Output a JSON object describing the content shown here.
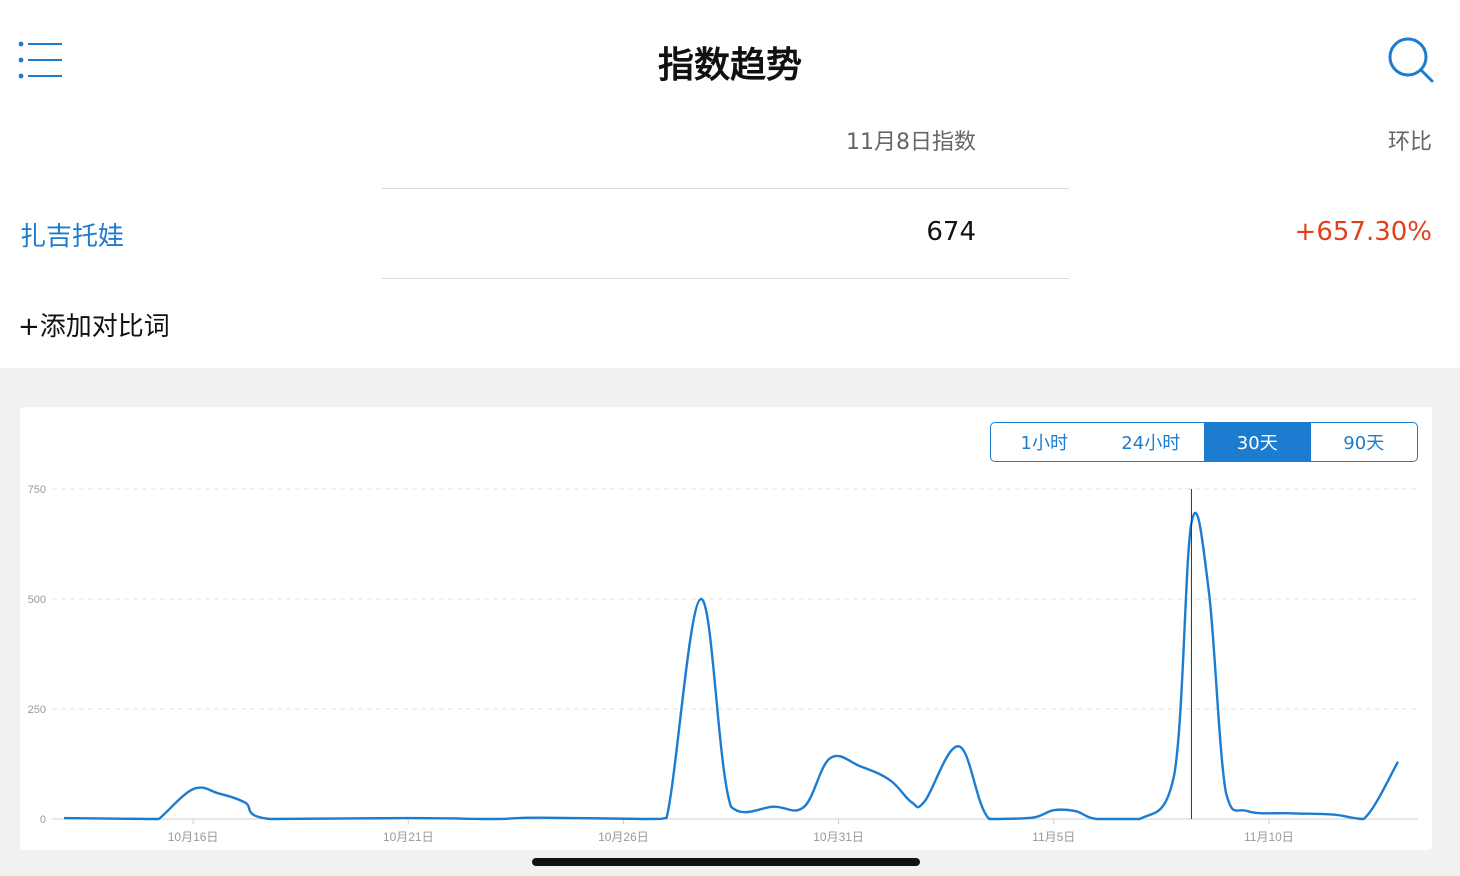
{
  "header": {
    "title": "指数趋势",
    "menu_icon": "menu-list-icon",
    "search_icon": "search-icon"
  },
  "summary": {
    "col_value_label": "11月8日指数",
    "col_ratio_label": "环比",
    "keyword": "扎吉托娃",
    "index_value": "674",
    "ratio_value": "+657.30%",
    "add_compare_label": "+添加对比词"
  },
  "range_tabs": [
    {
      "label": "1小时",
      "active": false
    },
    {
      "label": "24小时",
      "active": false
    },
    {
      "label": "30天",
      "active": true
    },
    {
      "label": "90天",
      "active": false
    }
  ],
  "colors": {
    "accent": "#1c7ccf",
    "positive_change": "#e2401d"
  },
  "chart_data": {
    "type": "line",
    "y_ticks": [
      0,
      250,
      500,
      750
    ],
    "ylim": [
      0,
      750
    ],
    "x_tick_labels": [
      "10月16日",
      "10月21日",
      "10月26日",
      "10月31日",
      "11月5日",
      "11月10日"
    ],
    "x_tick_days": [
      3,
      8,
      13,
      18,
      23,
      28
    ],
    "xlim": [
      0,
      31
    ],
    "grid": true,
    "cursor_day": 26.2,
    "series": [
      {
        "points": [
          [
            0,
            2
          ],
          [
            2,
            0
          ],
          [
            2.2,
            0
          ],
          [
            3,
            68
          ],
          [
            3.6,
            58
          ],
          [
            4.2,
            38
          ],
          [
            4.8,
            0
          ],
          [
            8,
            2
          ],
          [
            10,
            0
          ],
          [
            11,
            3
          ],
          [
            13.5,
            0
          ],
          [
            14,
            2
          ],
          [
            14.8,
            500
          ],
          [
            15.5,
            28
          ],
          [
            16.5,
            28
          ],
          [
            17.2,
            28
          ],
          [
            17.8,
            138
          ],
          [
            18.5,
            120
          ],
          [
            19.2,
            88
          ],
          [
            19.7,
            38
          ],
          [
            20,
            40
          ],
          [
            20.8,
            165
          ],
          [
            21.5,
            0
          ],
          [
            22.5,
            3
          ],
          [
            23,
            20
          ],
          [
            23.5,
            18
          ],
          [
            24,
            0
          ],
          [
            25,
            0
          ],
          [
            25.8,
            100
          ],
          [
            26.2,
            672
          ],
          [
            26.6,
            520
          ],
          [
            27,
            60
          ],
          [
            27.5,
            18
          ],
          [
            28.5,
            13
          ],
          [
            29.5,
            10
          ],
          [
            30.2,
            0
          ],
          [
            31,
            130
          ]
        ]
      }
    ]
  }
}
